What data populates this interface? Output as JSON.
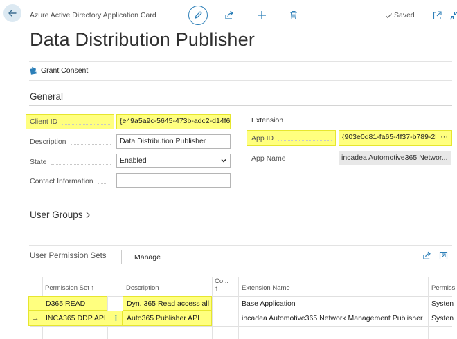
{
  "header": {
    "breadcrumb": "Azure Active Directory Application Card",
    "saved_label": "Saved"
  },
  "page_title": "Data Distribution Publisher",
  "actions": {
    "grant_consent": "Grant Consent"
  },
  "general": {
    "title": "General",
    "client_id": {
      "label": "Client ID",
      "value": "{e49a5a9c-5645-473b-adc2-d14f6"
    },
    "description": {
      "label": "Description",
      "value": "Data Distribution Publisher"
    },
    "state": {
      "label": "State",
      "value": "Enabled"
    },
    "contact": {
      "label": "Contact Information",
      "value": ""
    }
  },
  "extension": {
    "title": "Extension",
    "app_id": {
      "label": "App ID",
      "value": "{903e0d81-fa65-4f37-b789-2l",
      "more": "···"
    },
    "app_name": {
      "label": "App Name",
      "value": "incadea Automotive365 Networ..."
    }
  },
  "user_groups": {
    "title": "User Groups"
  },
  "permission_sets": {
    "title": "User Permission Sets",
    "manage": "Manage",
    "columns": {
      "permission_set": "Permission Set",
      "permission_set_sort": "↑",
      "description": "Description",
      "company_line1": "Co...",
      "company_line2": "↑",
      "extension_name": "Extension Name",
      "permission": "Permiss"
    },
    "rows": [
      {
        "permission_set": "D365 READ",
        "description": "Dyn. 365 Read access all",
        "extension_name": "Base Application",
        "scope": "Systen"
      },
      {
        "permission_set": "INCA365 DDP API",
        "description": "Auto365 Publisher API",
        "extension_name": "incadea Automotive365 Network Management Publisher",
        "scope": "Systen"
      }
    ],
    "current_row_marker": "→",
    "row_menu": "⋮"
  },
  "colors": {
    "accent": "#2c7fb8",
    "highlight": "#ffff7f",
    "highlight_border": "#e6e62e"
  }
}
